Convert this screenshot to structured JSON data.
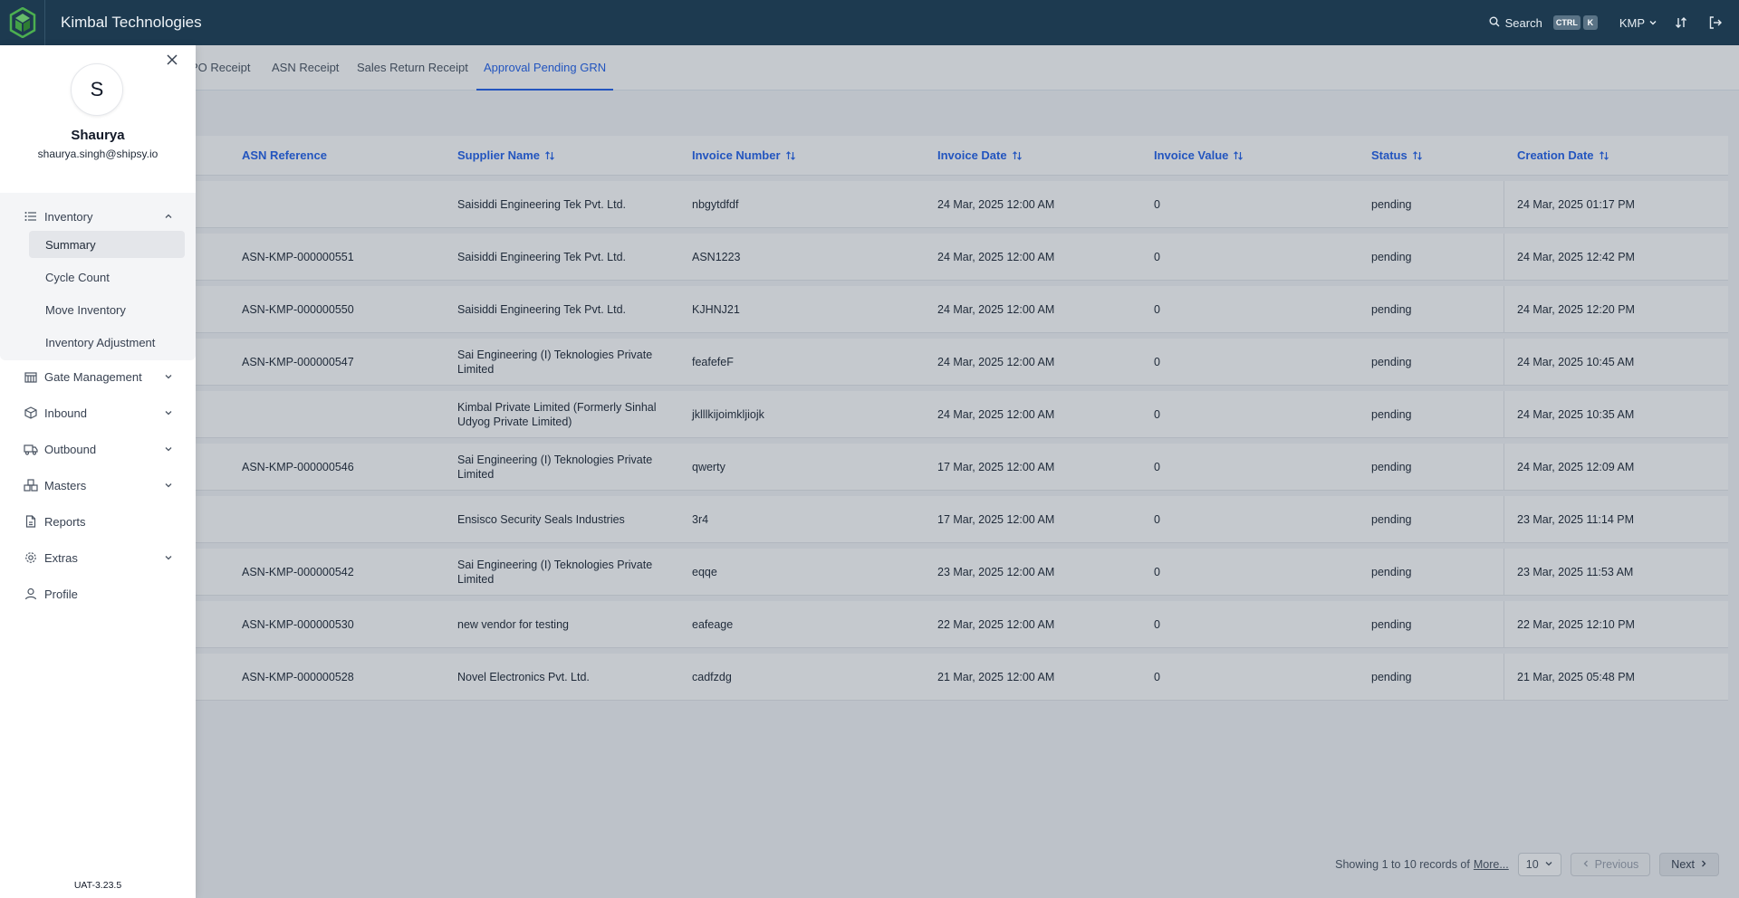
{
  "app": {
    "brand": "Kimbal Technologies",
    "search_label": "Search",
    "kbd_ctrl": "CTRL",
    "kbd_k": "K",
    "tenant": "KMP",
    "version": "UAT-3.23.5"
  },
  "tabs": [
    {
      "label": "PO Receipt"
    },
    {
      "label": "ASN Receipt"
    },
    {
      "label": "Sales Return Receipt"
    },
    {
      "label": "Approval Pending GRN",
      "active": true
    }
  ],
  "table": {
    "columns": [
      {
        "label": "ASN Reference",
        "sortable": false
      },
      {
        "label": "Supplier Name",
        "sortable": true
      },
      {
        "label": "Invoice Number",
        "sortable": true
      },
      {
        "label": "Invoice Date",
        "sortable": true
      },
      {
        "label": "Invoice Value",
        "sortable": true
      },
      {
        "label": "Status",
        "sortable": true
      },
      {
        "label": "Creation Date",
        "sortable": true
      }
    ],
    "rows": [
      {
        "asn": "",
        "supplier": "Saisiddi Engineering Tek Pvt. Ltd.",
        "invoice": "nbgytdfdf",
        "invoice_date": "24 Mar, 2025 12:00 AM",
        "value": "0",
        "status": "pending",
        "created": "24 Mar, 2025 01:17 PM"
      },
      {
        "asn": "ASN-KMP-000000551",
        "supplier": "Saisiddi Engineering Tek Pvt. Ltd.",
        "invoice": "ASN1223",
        "invoice_date": "24 Mar, 2025 12:00 AM",
        "value": "0",
        "status": "pending",
        "created": "24 Mar, 2025 12:42 PM"
      },
      {
        "asn": "ASN-KMP-000000550",
        "supplier": "Saisiddi Engineering Tek Pvt. Ltd.",
        "invoice": "KJHNJ21",
        "invoice_date": "24 Mar, 2025 12:00 AM",
        "value": "0",
        "status": "pending",
        "created": "24 Mar, 2025 12:20 PM"
      },
      {
        "asn": "ASN-KMP-000000547",
        "supplier": "Sai Engineering (I) Teknologies Private Limited",
        "invoice": "feafefeF",
        "invoice_date": "24 Mar, 2025 12:00 AM",
        "value": "0",
        "status": "pending",
        "created": "24 Mar, 2025 10:45 AM"
      },
      {
        "asn": "",
        "supplier": "Kimbal Private Limited (Formerly Sinhal Udyog Private Limited)",
        "invoice": "jklllkijoimkljiojk",
        "invoice_date": "24 Mar, 2025 12:00 AM",
        "value": "0",
        "status": "pending",
        "created": "24 Mar, 2025 10:35 AM"
      },
      {
        "asn": "ASN-KMP-000000546",
        "supplier": "Sai Engineering (I) Teknologies Private Limited",
        "invoice": "qwerty",
        "invoice_date": "17 Mar, 2025 12:00 AM",
        "value": "0",
        "status": "pending",
        "created": "24 Mar, 2025 12:09 AM"
      },
      {
        "asn": "",
        "supplier": "Ensisco Security Seals Industries",
        "invoice": "3r4",
        "invoice_date": "17 Mar, 2025 12:00 AM",
        "value": "0",
        "status": "pending",
        "created": "23 Mar, 2025 11:14 PM"
      },
      {
        "asn": "ASN-KMP-000000542",
        "supplier": "Sai Engineering (I) Teknologies Private Limited",
        "invoice": "eqqe",
        "invoice_date": "23 Mar, 2025 12:00 AM",
        "value": "0",
        "status": "pending",
        "created": "23 Mar, 2025 11:53 AM"
      },
      {
        "asn": "ASN-KMP-000000530",
        "supplier": "new vendor for testing",
        "invoice": "eafeage",
        "invoice_date": "22 Mar, 2025 12:00 AM",
        "value": "0",
        "status": "pending",
        "created": "22 Mar, 2025 12:10 PM"
      },
      {
        "asn": "ASN-KMP-000000528",
        "supplier": "Novel Electronics Pvt. Ltd.",
        "invoice": "cadfzdg",
        "invoice_date": "21 Mar, 2025 12:00 AM",
        "value": "0",
        "status": "pending",
        "created": "21 Mar, 2025 05:48 PM"
      }
    ]
  },
  "pagination": {
    "summary": "Showing 1 to 10 records of",
    "more": "More...",
    "page_size": "10",
    "prev": "Previous",
    "next": "Next"
  },
  "drawer": {
    "avatar_initial": "S",
    "name": "Shaurya",
    "email": "shaurya.singh@shipsy.io",
    "nav": {
      "inventory": "Inventory",
      "inventory_sub": [
        "Summary",
        "Cycle Count",
        "Move Inventory",
        "Inventory Adjustment"
      ],
      "active_sub": "Summary",
      "gate": "Gate Management",
      "inbound": "Inbound",
      "outbound": "Outbound",
      "masters": "Masters",
      "reports": "Reports",
      "extras": "Extras",
      "profile": "Profile"
    }
  },
  "colors": {
    "topbar": "#1d3a50",
    "accent": "#2563eb",
    "logo_green": "#4caf50"
  },
  "icons": [
    "app-logo-icon",
    "search-icon",
    "sort-order-icon",
    "logout-icon",
    "close-icon",
    "list-icon",
    "gate-icon",
    "inbound-box-icon",
    "truck-icon",
    "masters-icon",
    "reports-icon",
    "extras-gear-icon",
    "profile-user-icon",
    "sort-icon",
    "chevron-down-icon",
    "chevron-up-icon",
    "chevron-left-icon",
    "chevron-right-icon"
  ]
}
